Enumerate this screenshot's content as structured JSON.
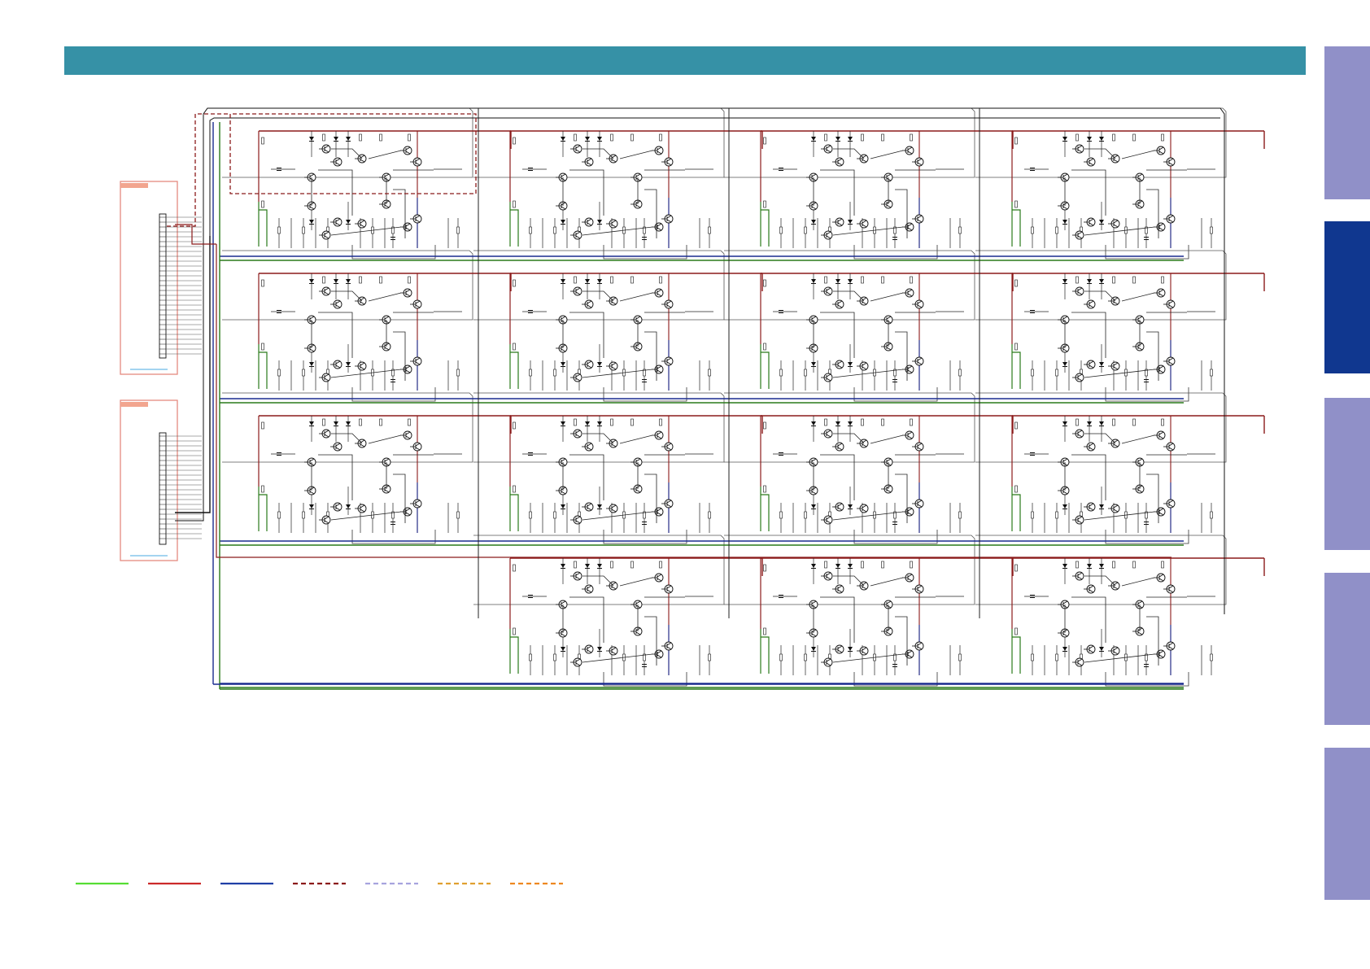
{
  "header": {
    "color": "#3691a6"
  },
  "side_tabs": [
    {
      "id": "tab-1",
      "color": "#9090c8",
      "active": false
    },
    {
      "id": "tab-2",
      "color": "#10378f",
      "active": true
    },
    {
      "id": "tab-3",
      "color": "#9090c8",
      "active": false
    },
    {
      "id": "tab-4",
      "color": "#9090c8",
      "active": false
    },
    {
      "id": "tab-5",
      "color": "#9090c8",
      "active": false
    }
  ],
  "schematic": {
    "rows": 4,
    "columns": 4,
    "present_cells": [
      [
        true,
        true,
        true,
        true
      ],
      [
        true,
        true,
        true,
        true
      ],
      [
        true,
        true,
        true,
        true
      ],
      [
        false,
        true,
        true,
        true
      ]
    ],
    "connectors": 2,
    "wire_colors": {
      "positive_rail": "#8b1a1a",
      "negative_rail": "#1a2b8f",
      "ground": "#2a7a1a",
      "signal": "#111111",
      "connector_frame": "#e58a80",
      "connector_label": "#f2a58f",
      "connector_underline": "#4aa8e0"
    }
  },
  "legend": {
    "lines": [
      {
        "color": "#55dd33",
        "style": "solid"
      },
      {
        "color": "#cc2a2a",
        "style": "solid"
      },
      {
        "color": "#1f3fa6",
        "style": "solid"
      },
      {
        "color": "#8b1a1a",
        "style": "dashed"
      },
      {
        "color": "#a7a3de",
        "style": "dashed"
      },
      {
        "color": "#e0a030",
        "style": "dashed"
      },
      {
        "color": "#ee8820",
        "style": "dashed"
      }
    ]
  }
}
